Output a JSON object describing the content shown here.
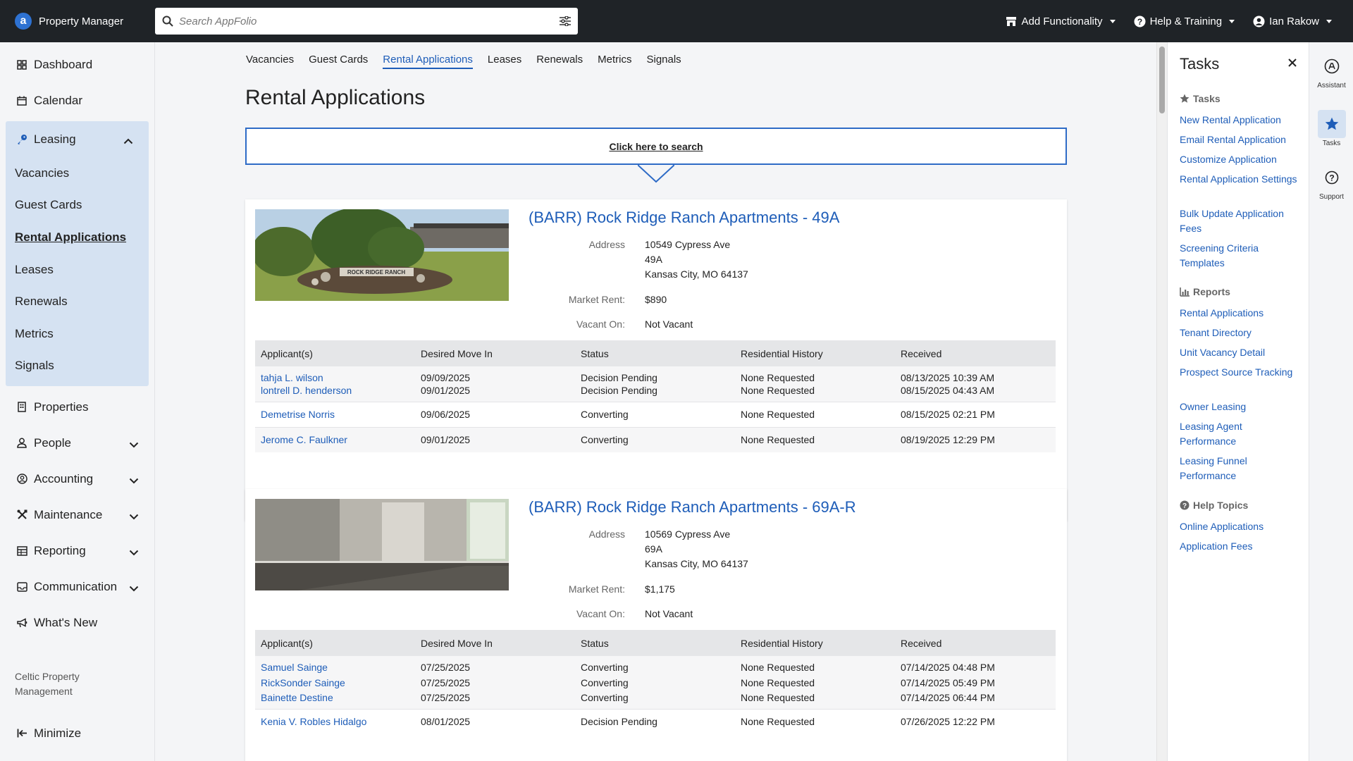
{
  "topbar": {
    "brand": "Property Manager",
    "search_placeholder": "Search AppFolio",
    "add_functionality": "Add Functionality",
    "help_training": "Help & Training",
    "user": "Ian Rakow"
  },
  "sidebar": {
    "dashboard": "Dashboard",
    "calendar": "Calendar",
    "leasing": "Leasing",
    "leasing_items": [
      "Vacancies",
      "Guest Cards",
      "Rental Applications",
      "Leases",
      "Renewals",
      "Metrics",
      "Signals"
    ],
    "properties": "Properties",
    "people": "People",
    "accounting": "Accounting",
    "maintenance": "Maintenance",
    "reporting": "Reporting",
    "communication": "Communication",
    "whats_new": "What's New",
    "company": "Celtic Property Management",
    "minimize": "Minimize"
  },
  "tabs": [
    "Vacancies",
    "Guest Cards",
    "Rental Applications",
    "Leases",
    "Renewals",
    "Metrics",
    "Signals"
  ],
  "page_title": "Rental Applications",
  "search_prompt": "Click here to search",
  "labels": {
    "address": "Address",
    "market_rent": "Market Rent:",
    "vacant_on": "Vacant On:"
  },
  "table_headers": [
    "Applicant(s)",
    "Desired Move In",
    "Status",
    "Residential History",
    "Received"
  ],
  "listings": [
    {
      "title": "(BARR) Rock Ridge Ranch Apartments - 49A",
      "address": [
        "10549 Cypress Ave",
        "49A",
        "Kansas City, MO 64137"
      ],
      "market_rent": "$890",
      "vacant_on": "Not Vacant",
      "image_text": "ROCK RIDGE RANCH",
      "groups": [
        [
          {
            "name": "tahja L. wilson",
            "move_in": "09/09/2025",
            "status": "Decision Pending",
            "history": "None Requested",
            "received": "08/13/2025 10:39 AM"
          },
          {
            "name": "lontrell D. henderson",
            "move_in": "09/01/2025",
            "status": "Decision Pending",
            "history": "None Requested",
            "received": "08/15/2025 04:43 AM"
          }
        ],
        [
          {
            "name": "Demetrise Norris",
            "move_in": "09/06/2025",
            "status": "Converting",
            "history": "None Requested",
            "received": "08/15/2025 02:21 PM"
          }
        ],
        [
          {
            "name": "Jerome C. Faulkner",
            "move_in": "09/01/2025",
            "status": "Converting",
            "history": "None Requested",
            "received": "08/19/2025 12:29 PM"
          }
        ]
      ]
    },
    {
      "title": "(BARR) Rock Ridge Ranch Apartments - 69A-R",
      "address": [
        "10569 Cypress Ave",
        "69A",
        "Kansas City, MO 64137"
      ],
      "market_rent": "$1,175",
      "vacant_on": "Not Vacant",
      "groups": [
        [
          {
            "name": "Samuel Sainge",
            "move_in": "07/25/2025",
            "status": "Converting",
            "history": "None Requested",
            "received": "07/14/2025 04:48 PM"
          },
          {
            "name": "RickSonder Sainge",
            "move_in": "07/25/2025",
            "status": "Converting",
            "history": "None Requested",
            "received": "07/14/2025 05:49 PM"
          },
          {
            "name": "Bainette Destine",
            "move_in": "07/25/2025",
            "status": "Converting",
            "history": "None Requested",
            "received": "07/14/2025 06:44 PM"
          }
        ],
        [
          {
            "name": "Kenia V. Robles Hidalgo",
            "move_in": "08/01/2025",
            "status": "Decision Pending",
            "history": "None Requested",
            "received": "07/26/2025 12:22 PM"
          }
        ]
      ]
    }
  ],
  "tasks": {
    "title": "Tasks",
    "tasks_heading": "Tasks",
    "tasks_links": [
      "New Rental Application",
      "Email Rental Application",
      "Customize Application",
      "Rental Application Settings",
      "Bulk Update Application Fees",
      "Screening Criteria Templates"
    ],
    "reports_heading": "Reports",
    "reports_links": [
      "Rental Applications",
      "Tenant Directory",
      "Unit Vacancy Detail",
      "Prospect Source Tracking",
      "Owner Leasing",
      "Leasing Agent Performance",
      "Leasing Funnel Performance"
    ],
    "help_heading": "Help Topics",
    "help_links": [
      "Online Applications",
      "Application Fees"
    ]
  },
  "rail": {
    "assistant": "Assistant",
    "tasks": "Tasks",
    "support": "Support"
  },
  "colors": {
    "topbar": "#1f2327",
    "accent": "#1e5db8",
    "leasing_bg": "#d5e2f2"
  }
}
